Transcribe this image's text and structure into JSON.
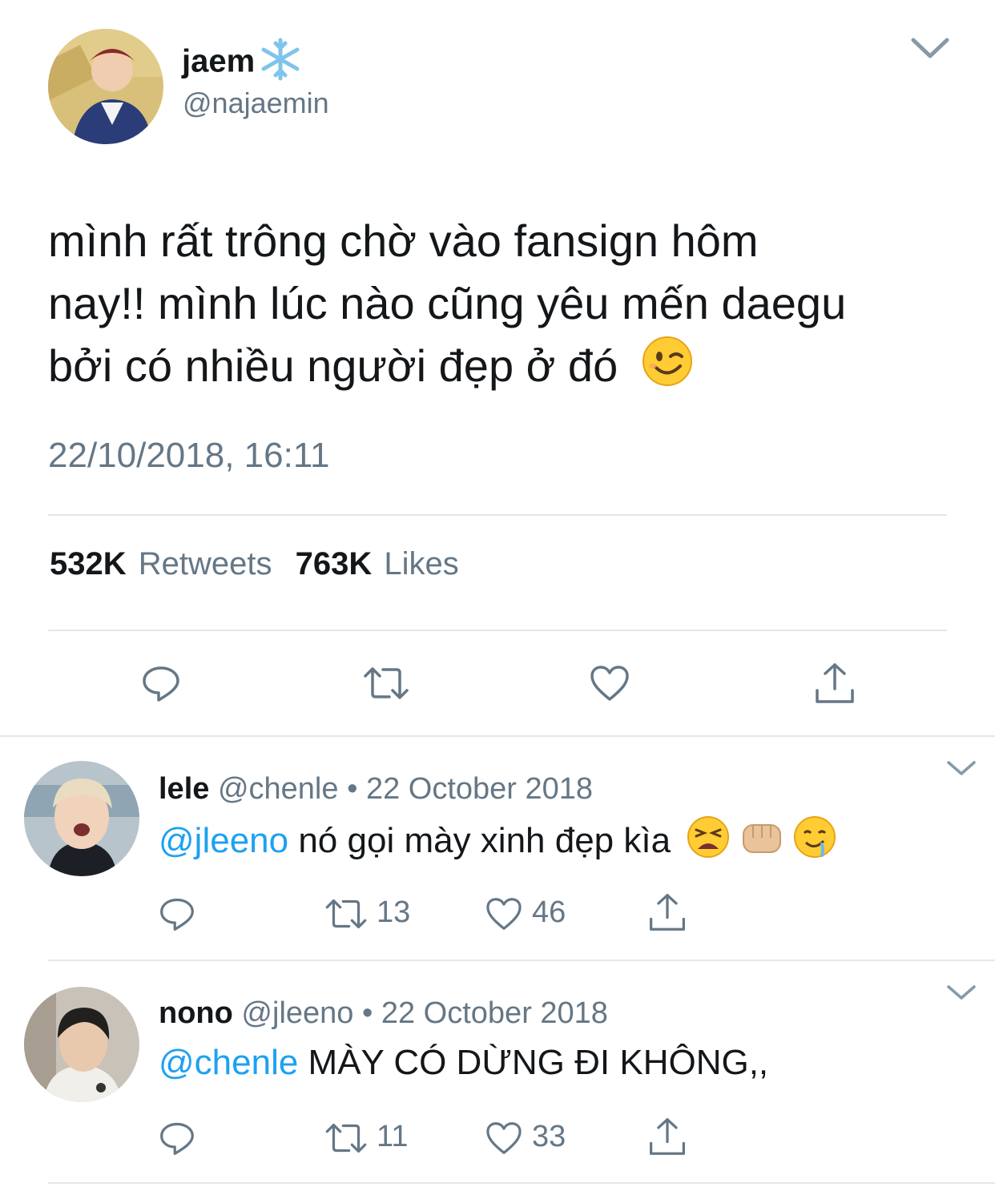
{
  "main_tweet": {
    "display_name": "jaem",
    "name_emoji": "snowflake-icon",
    "handle": "@najaemin",
    "text_lines": [
      "mình rất trông chờ vào fansign hôm",
      "nay!! mình lúc nào cũng yêu mến daegu",
      "bởi có nhiều người đẹp ở đó"
    ],
    "text_emoji": "winking-face-emoji",
    "timestamp": "22/10/2018, 16:11",
    "retweets_count": "532K",
    "retweets_label": "Retweets",
    "likes_count": "763K",
    "likes_label": "Likes"
  },
  "replies": [
    {
      "display_name": "lele",
      "handle": "@chenle",
      "date": "• 22 October 2018",
      "mention": "@jleeno",
      "text": " nó gọi mày xinh đẹp kìa",
      "emojis": [
        "tired-face-emoji",
        "fist-emoji",
        "drooling-face-emoji"
      ],
      "retweets": "13",
      "likes": "46"
    },
    {
      "display_name": "nono",
      "handle": "@jleeno",
      "date": "• 22 October 2018",
      "mention": "@chenle",
      "text": " MÀY CÓ DỪNG ĐI KHÔNG,,",
      "retweets": "11",
      "likes": "33"
    }
  ],
  "colors": {
    "text": "#14171a",
    "secondary": "#657786",
    "link": "#1da1f2",
    "divider": "#e1e8ed"
  }
}
